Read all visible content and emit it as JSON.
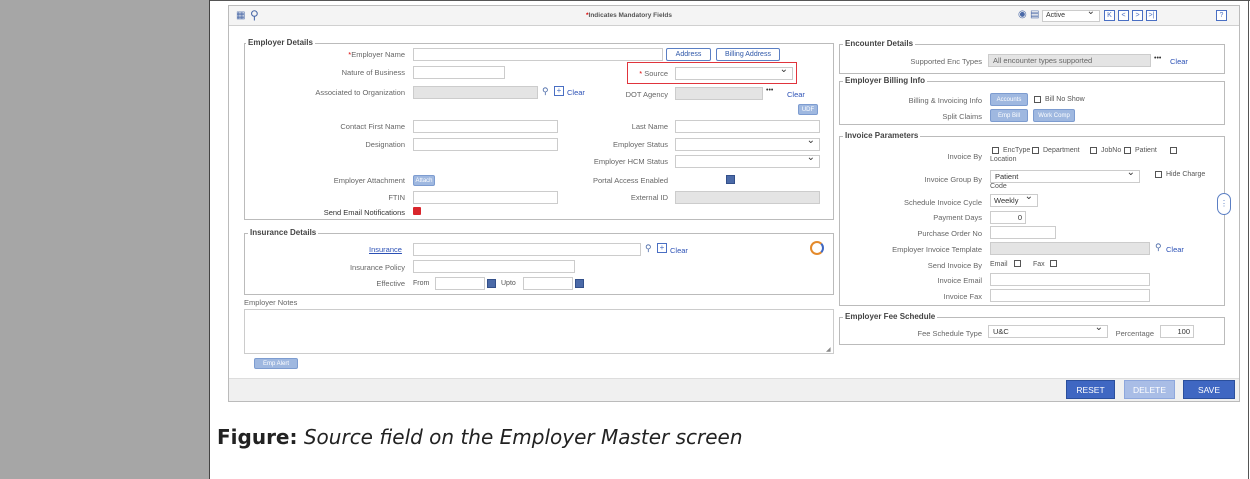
{
  "toolbar": {
    "mandatory_note": "Indicates Mandatory Fields",
    "status_value": "Active",
    "nav": [
      "K",
      "<",
      ">",
      ">|"
    ],
    "help": "?"
  },
  "employer_details": {
    "legend": "Employer Details",
    "employer_name": "Employer Name",
    "address_btn": "Address",
    "billing_address_btn": "Billing Address",
    "nature_of_business": "Nature of Business",
    "source": "Source",
    "associated_org": "Associated to Organization",
    "clear": "Clear",
    "dot_agency": "DOT Agency",
    "dots": "•••",
    "udf": "UDF",
    "contact_first_name": "Contact First Name",
    "last_name": "Last Name",
    "designation": "Designation",
    "employer_status": "Employer Status",
    "employer_hcm_status": "Employer HCM Status",
    "employer_attachment": "Employer Attachment",
    "attach_btn": "Attach",
    "portal_access": "Portal Access Enabled",
    "ftin": "FTIN",
    "external_id": "External ID",
    "send_email": "Send Email Notifications"
  },
  "insurance": {
    "legend": "Insurance Details",
    "insurance": "Insurance",
    "clear": "Clear",
    "insurance_policy": "Insurance Policy",
    "effective": "Effective",
    "from": "From",
    "upto": "Upto"
  },
  "notes": {
    "label": "Employer Notes",
    "emp_alert": "Emp Alert"
  },
  "encounter": {
    "legend": "Encounter Details",
    "supported_label": "Supported Enc Types",
    "supported_value": "All encounter types supported",
    "clear": "Clear"
  },
  "billing": {
    "legend": "Employer Billing Info",
    "billing_label": "Billing & Invoicing Info",
    "accounts_btn": "Accounts",
    "bill_no_show": "Bill No Show",
    "split_claims": "Split Claims",
    "emp_bill_btn": "Emp Bill",
    "work_comp_btn": "Work Comp"
  },
  "invoice": {
    "legend": "Invoice Parameters",
    "invoice_by": "Invoice By",
    "opts": [
      "EncType",
      "Department",
      "JobNo",
      "Patient"
    ],
    "location": "Location",
    "group_by": "Invoice Group By",
    "group_value": "Patient",
    "hide_charge": "Hide Charge",
    "code": "Code",
    "cycle_label": "Schedule Invoice Cycle",
    "cycle_value": "Weekly",
    "payment_days": "Payment Days",
    "payment_value": "0",
    "po_no": "Purchase Order No",
    "template": "Employer Invoice Template",
    "clear": "Clear",
    "send_by": "Send Invoice By",
    "email_opt": "Email",
    "fax_opt": "Fax",
    "invoice_email": "Invoice Email",
    "invoice_fax": "Invoice Fax"
  },
  "fee": {
    "legend": "Employer Fee Schedule",
    "type_label": "Fee Schedule Type",
    "type_value": "U&C",
    "percentage_label": "Percentage",
    "percentage_value": "100"
  },
  "actions": {
    "reset": "RESET",
    "delete": "DELETE",
    "save": "SAVE"
  },
  "caption": {
    "bold": "Figure:",
    "text": "Source field on the Employer Master screen"
  },
  "colors": {
    "accent": "#3f67c2",
    "highlight_box": "#e0343c",
    "left_column": "#a6a6a6"
  }
}
